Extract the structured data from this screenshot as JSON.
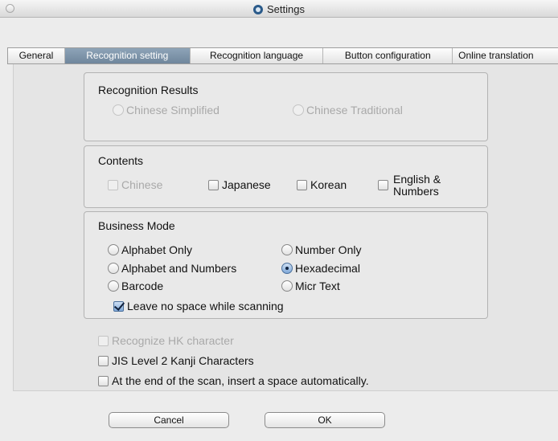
{
  "window": {
    "title": "Settings"
  },
  "tabs": [
    {
      "label": "General"
    },
    {
      "label": "Recognition setting"
    },
    {
      "label": "Recognition language"
    },
    {
      "label": "Button configuration"
    },
    {
      "label": "Online translation"
    }
  ],
  "recognition_results": {
    "title": "Recognition Results",
    "options": [
      {
        "label": "Chinese Simplified",
        "selected": false,
        "enabled": false
      },
      {
        "label": "Chinese Traditional",
        "selected": false,
        "enabled": false
      }
    ]
  },
  "contents": {
    "title": "Contents",
    "options": [
      {
        "label": "Chinese",
        "checked": false,
        "enabled": false
      },
      {
        "label": "Japanese",
        "checked": false,
        "enabled": true
      },
      {
        "label": "Korean",
        "checked": false,
        "enabled": true
      },
      {
        "label_line1": "English &",
        "label_line2": "Numbers",
        "checked": false,
        "enabled": true
      }
    ]
  },
  "business_mode": {
    "title": "Business Mode",
    "options": [
      {
        "label": "Alphabet Only",
        "selected": false
      },
      {
        "label": "Number Only",
        "selected": false
      },
      {
        "label": "Alphabet and Numbers",
        "selected": false
      },
      {
        "label": "Hexadecimal",
        "selected": true
      },
      {
        "label": "Barcode",
        "selected": false
      },
      {
        "label": "Micr Text",
        "selected": false
      }
    ],
    "leave_no_space": {
      "label": "Leave no space while scanning",
      "checked": true
    }
  },
  "extra_options": [
    {
      "label": "Recognize HK character",
      "checked": false,
      "enabled": false
    },
    {
      "label": "JIS Level 2 Kanji Characters",
      "checked": false,
      "enabled": true
    },
    {
      "label": "At the end of the scan, insert a space automatically.",
      "checked": false,
      "enabled": true
    }
  ],
  "buttons": {
    "cancel": "Cancel",
    "ok": "OK"
  },
  "colors": {
    "active_tab": "#7d93a9",
    "selected_radio": "#7fa8d8"
  }
}
